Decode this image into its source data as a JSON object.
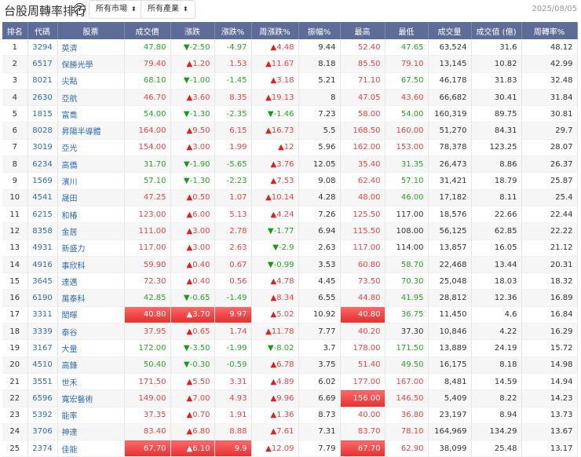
{
  "header": {
    "title": "台股周轉率排行",
    "help_icon": "?",
    "market_select": "所有市場",
    "industry_select": "所有產業",
    "date": "2025/08/05"
  },
  "columns": [
    "排名",
    "代碼",
    "股票",
    "成交價",
    "漲跌",
    "漲跌%",
    "周漲跌%",
    "振幅%",
    "最高",
    "最低",
    "成交量",
    "成交值 (億)",
    "周轉率%"
  ],
  "colors": {
    "header_bg": "#5e6d97",
    "up": "#e64545",
    "down": "#2aa52a",
    "link": "#2f6cb3"
  },
  "rows": [
    {
      "rank": "1",
      "code": "3294",
      "name": "英濟",
      "price": "47.80",
      "chg": "-2.50",
      "pct": "-4.97",
      "wk": "4.48",
      "amp": "9.44",
      "high": "52.40",
      "low": "47.65",
      "vol": "63,524",
      "val": "31.6",
      "turn": "48.12"
    },
    {
      "rank": "2",
      "code": "6517",
      "name": "保勝光學",
      "price": "79.40",
      "chg": "1.20",
      "pct": "1.53",
      "wk": "11.67",
      "amp": "8.18",
      "high": "85.50",
      "low": "79.10",
      "vol": "13,145",
      "val": "10.82",
      "turn": "42.99"
    },
    {
      "rank": "3",
      "code": "8021",
      "name": "尖點",
      "price": "68.10",
      "chg": "-1.00",
      "pct": "-1.45",
      "wk": "3.18",
      "amp": "5.21",
      "high": "71.10",
      "low": "67.50",
      "vol": "46,178",
      "val": "31.83",
      "turn": "32.48"
    },
    {
      "rank": "4",
      "code": "2630",
      "name": "亞航",
      "price": "46.70",
      "chg": "3.60",
      "pct": "8.35",
      "wk": "19.13",
      "amp": "8",
      "high": "47.05",
      "low": "43.60",
      "vol": "66,682",
      "val": "30.41",
      "turn": "31.84"
    },
    {
      "rank": "5",
      "code": "1815",
      "name": "富喬",
      "price": "54.00",
      "chg": "-1.30",
      "pct": "-2.35",
      "wk": "-1.46",
      "amp": "7.23",
      "high": "58.00",
      "low": "54.00",
      "vol": "160,319",
      "val": "89.75",
      "turn": "30.81"
    },
    {
      "rank": "6",
      "code": "8028",
      "name": "昇陽半導體",
      "price": "164.00",
      "chg": "9.50",
      "pct": "6.15",
      "wk": "16.73",
      "amp": "5.5",
      "high": "168.50",
      "low": "160.00",
      "vol": "51,270",
      "val": "84.31",
      "turn": "29.7"
    },
    {
      "rank": "7",
      "code": "3019",
      "name": "亞光",
      "price": "154.00",
      "chg": "3.00",
      "pct": "1.99",
      "wk": "12",
      "amp": "5.96",
      "high": "162.00",
      "low": "153.00",
      "vol": "78,378",
      "val": "123.25",
      "turn": "28.07"
    },
    {
      "rank": "8",
      "code": "6234",
      "name": "高僑",
      "price": "31.70",
      "chg": "-1.90",
      "pct": "-5.65",
      "wk": "3.76",
      "amp": "12.05",
      "high": "35.40",
      "low": "31.35",
      "vol": "26,473",
      "val": "8.86",
      "turn": "26.37"
    },
    {
      "rank": "9",
      "code": "1569",
      "name": "濱川",
      "price": "57.10",
      "chg": "-1.30",
      "pct": "-2.23",
      "wk": "7.53",
      "amp": "9.08",
      "high": "62.40",
      "low": "57.10",
      "vol": "31,421",
      "val": "18.79",
      "turn": "25.87"
    },
    {
      "rank": "10",
      "code": "4541",
      "name": "晟田",
      "price": "47.25",
      "chg": "0.50",
      "pct": "1.07",
      "wk": "10.14",
      "amp": "4.28",
      "high": "48.00",
      "low": "46.00",
      "vol": "17,182",
      "val": "8.11",
      "turn": "25.4"
    },
    {
      "rank": "11",
      "code": "6215",
      "name": "和椿",
      "price": "123.00",
      "chg": "6.00",
      "pct": "5.13",
      "wk": "4.24",
      "amp": "7.26",
      "high": "125.50",
      "low": "117.00",
      "vol": "18,576",
      "val": "22.66",
      "turn": "22.44"
    },
    {
      "rank": "12",
      "code": "8358",
      "name": "金居",
      "price": "111.00",
      "chg": "3.00",
      "pct": "2.78",
      "wk": "-1.77",
      "amp": "6.94",
      "high": "115.50",
      "low": "108.00",
      "vol": "56,125",
      "val": "62.85",
      "turn": "22.22"
    },
    {
      "rank": "13",
      "code": "4931",
      "name": "新盛力",
      "price": "117.00",
      "chg": "3.00",
      "pct": "2.63",
      "wk": "-2.9",
      "amp": "2.63",
      "high": "117.00",
      "low": "114.00",
      "vol": "13,857",
      "val": "16.05",
      "turn": "21.12"
    },
    {
      "rank": "14",
      "code": "4916",
      "name": "事欣科",
      "price": "59.90",
      "chg": "0.40",
      "pct": "0.67",
      "wk": "-0.99",
      "amp": "3.53",
      "high": "60.80",
      "low": "58.70",
      "vol": "22,468",
      "val": "13.44",
      "turn": "20.31"
    },
    {
      "rank": "15",
      "code": "3645",
      "name": "達邁",
      "price": "72.30",
      "chg": "0.40",
      "pct": "0.56",
      "wk": "4.78",
      "amp": "4.45",
      "high": "73.50",
      "low": "70.30",
      "vol": "25,048",
      "val": "18.03",
      "turn": "18.32"
    },
    {
      "rank": "16",
      "code": "6190",
      "name": "萬泰科",
      "price": "42.85",
      "chg": "-0.65",
      "pct": "-1.49",
      "wk": "8.34",
      "amp": "6.55",
      "high": "44.80",
      "low": "41.95",
      "vol": "28,812",
      "val": "12.36",
      "turn": "16.89"
    },
    {
      "rank": "17",
      "code": "3311",
      "name": "閎暉",
      "price": "40.80",
      "chg": "3.70",
      "pct": "9.97",
      "wk": "5.02",
      "amp": "10.92",
      "high": "40.80",
      "low": "36.75",
      "vol": "11,450",
      "val": "4.6",
      "turn": "16.84",
      "limit": true,
      "high_limit": true
    },
    {
      "rank": "18",
      "code": "3339",
      "name": "泰谷",
      "price": "37.95",
      "chg": "0.65",
      "pct": "1.74",
      "wk": "11.78",
      "amp": "7.77",
      "high": "40.20",
      "low": "37.30",
      "vol": "10,846",
      "val": "4.22",
      "turn": "16.29"
    },
    {
      "rank": "19",
      "code": "3167",
      "name": "大量",
      "price": "172.00",
      "chg": "-3.50",
      "pct": "-1.99",
      "wk": "-8.02",
      "amp": "3.7",
      "high": "178.00",
      "low": "171.50",
      "vol": "13,889",
      "val": "24.19",
      "turn": "15.72"
    },
    {
      "rank": "20",
      "code": "4510",
      "name": "高鋒",
      "price": "50.40",
      "chg": "-0.30",
      "pct": "-0.59",
      "wk": "6.78",
      "amp": "3.75",
      "high": "51.40",
      "low": "49.50",
      "vol": "16,175",
      "val": "8.18",
      "turn": "14.98"
    },
    {
      "rank": "21",
      "code": "3551",
      "name": "世禾",
      "price": "171.50",
      "chg": "5.50",
      "pct": "3.31",
      "wk": "4.89",
      "amp": "6.02",
      "high": "177.00",
      "low": "167.00",
      "vol": "8,481",
      "val": "14.59",
      "turn": "14.94"
    },
    {
      "rank": "22",
      "code": "6596",
      "name": "寬宏藝術",
      "price": "149.00",
      "chg": "7.00",
      "pct": "4.93",
      "wk": "9.96",
      "amp": "6.69",
      "high": "156.00",
      "low": "146.50",
      "vol": "5,409",
      "val": "8.22",
      "turn": "14.23",
      "high_limit": true
    },
    {
      "rank": "23",
      "code": "5392",
      "name": "能率",
      "price": "37.35",
      "chg": "0.70",
      "pct": "1.91",
      "wk": "1.36",
      "amp": "8.73",
      "high": "40.00",
      "low": "36.80",
      "vol": "23,197",
      "val": "8.94",
      "turn": "13.73"
    },
    {
      "rank": "24",
      "code": "3706",
      "name": "神達",
      "price": "83.40",
      "chg": "6.80",
      "pct": "8.88",
      "wk": "7.61",
      "amp": "7.31",
      "high": "83.70",
      "low": "78.10",
      "vol": "164,969",
      "val": "134.29",
      "turn": "13.67"
    },
    {
      "rank": "25",
      "code": "2374",
      "name": "佳能",
      "price": "67.70",
      "chg": "6.10",
      "pct": "9.9",
      "wk": "12.09",
      "amp": "7.79",
      "high": "67.70",
      "low": "62.90",
      "vol": "38,099",
      "val": "25.48",
      "turn": "13.17",
      "limit": true,
      "high_limit": true
    }
  ]
}
